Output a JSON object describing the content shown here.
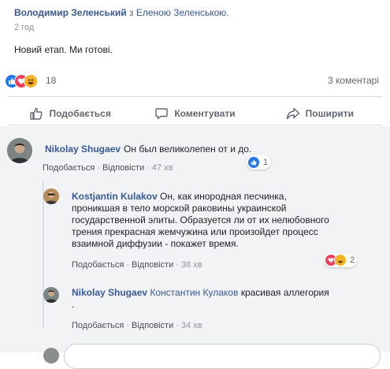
{
  "post": {
    "author": "Володимир Зеленський",
    "with_text": "з",
    "tagged": "Еленою Зеленською.",
    "time": "2 год",
    "text": "Новий етап. Ми готові."
  },
  "reactions": {
    "count": "18",
    "comments": "3 коментарі",
    "icons": [
      "like-icon",
      "love-icon",
      "haha-icon"
    ]
  },
  "actions": {
    "like": "Подобається",
    "comment": "Коментувати",
    "share": "Поширити"
  },
  "comments": [
    {
      "name": "Nikolay Shugaev",
      "text": "Он был великолепен от и до.",
      "like": "Подобається",
      "reply": "Відповісти",
      "time": "47 хв",
      "react_count": "1"
    },
    {
      "name": "Kostjantin Kulakov",
      "text": "Он, как инородная песчинка, проникшая в тело морской раковины украинской государственной элиты. Образуется ли от их нелюбовного трения прекрасная жемчужина или произойдет процесс взаимной диффузии - покажет время.",
      "like": "Подобається",
      "reply": "Відповісти",
      "time": "38 хв",
      "react_count": "2"
    },
    {
      "name": "Nikolay Shugaev",
      "mention": "Константин Кулаков",
      "text": "красивая аллегория",
      "text2": ".",
      "like": "Подобається",
      "reply": "Відповісти",
      "time": "34 хв"
    }
  ],
  "colors": {
    "link": "#385898",
    "like_blue": "#2078f4",
    "love": "#f33e58",
    "haha": "#f7b125"
  }
}
